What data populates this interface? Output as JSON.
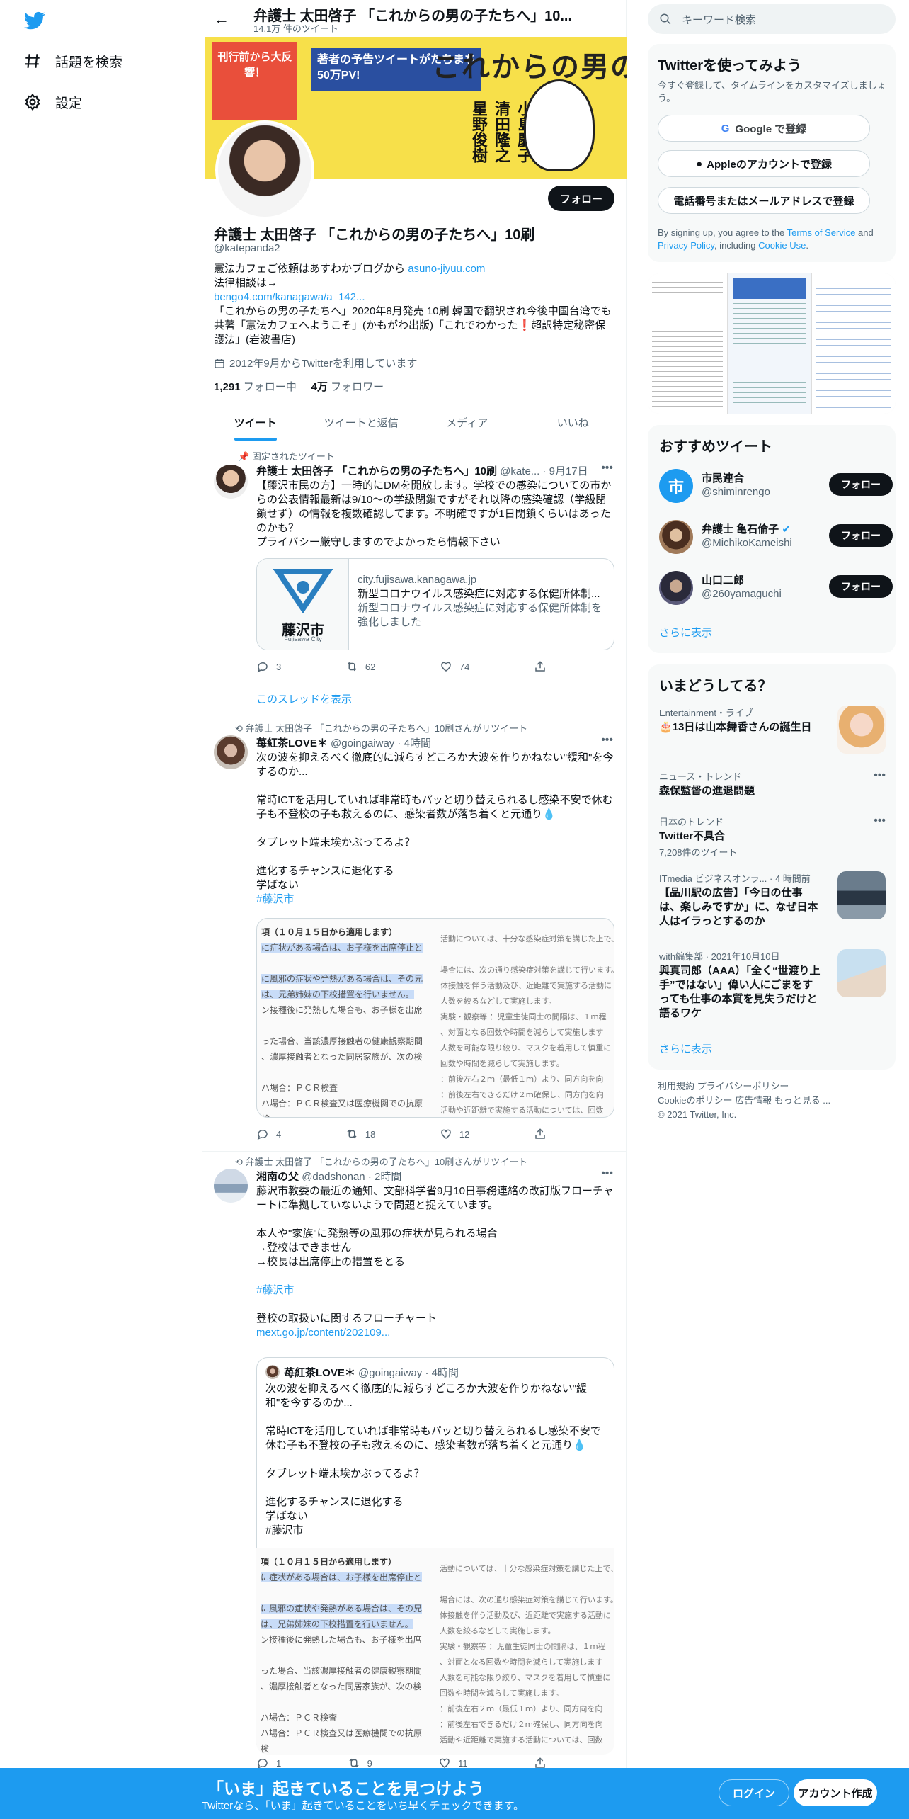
{
  "nav": {
    "explore_label": "話題を検索",
    "settings_label": "設定"
  },
  "header": {
    "title": "弁護士 太田啓子 「これからの男の子たちへ」10...",
    "tweet_count": "14.1万 件のツイート"
  },
  "banner": {
    "title": "これからの男の子たちへ",
    "badge": "刊行前から大反響！",
    "promo": "著者の予告ツイートがたちまち50万PV!",
    "names": "小島慶子 清田隆之 星野俊樹"
  },
  "profile": {
    "follow_label": "フォロー",
    "name": "弁護士 太田啓子 「これからの男の子たちへ」10刷",
    "handle": "@katepanda2",
    "bio_line1": "憲法カフェご依頼はあすわかブログから",
    "bio_link1": "asuno-jiyuu.com",
    "bio_line2": "法律相談は→",
    "bio_link2": "bengo4.com/kanagawa/a_142...",
    "bio_line3": "「これからの男の子たちへ」2020年8月発売 10刷 韓国で翻訳され今後中国台湾でも",
    "bio_line4": "共著「憲法カフェへようこそ」(かもがわ出版)「これでわかった❗超訳特定秘密保",
    "bio_line5": "護法」(岩波書店)",
    "joined": "2012年9月からTwitterを利用しています",
    "following_count": "1,291",
    "following_label": "フォロー中",
    "followers_count": "4万",
    "followers_label": "フォロワー"
  },
  "tabs": [
    "ツイート",
    "ツイートと返信",
    "メディア",
    "いいね"
  ],
  "tweet1": {
    "context": "固定されたツイート",
    "name": "弁護士 太田啓子 「これからの男の子たちへ」10刷",
    "meta": "@kate... · 9月17日",
    "lines": [
      "【藤沢市民の方】一時的にDMを開放します。学校での感染についての市か",
      "らの公表情報最新は9/10～の学級閉鎖ですがそれ以降の感染確認（学級閉",
      "鎖せず）の情報を複数確認してます。不明確ですが1日閉鎖くらいはあった",
      "のかも？",
      "プライバシー厳守しますのでよかったら情報下さい"
    ],
    "card_domain": "city.fujisawa.kanagawa.jp",
    "card_title": "新型コロナウイルス感染症に対応する保健所体制...",
    "card_desc1": "新型コロナウイルス感染症に対応する保健所体制を",
    "card_desc2": "強化しました",
    "card_logo_text": "藤沢市",
    "card_logo_sub": "Fujisawa City",
    "replies": "3",
    "retweets": "62",
    "likes": "74",
    "thread_link": "このスレッドを表示"
  },
  "tweet2": {
    "context": "弁護士 太田啓子 「これからの男の子たちへ」10刷さんがリツイート",
    "name": "苺紅茶LOVE＊",
    "meta": "@goingaiway · 4時間",
    "lines": [
      "次の波を抑えるべく徹底的に減らすどころか大波を作りかねない\"緩和\"を今",
      "するのか...",
      "",
      "常時ICTを活用していれば非常時もパッと切り替えられるし感染不安で休む",
      "子も不登校の子も救えるのに、感染者数が落ち着くと元通り💧",
      "",
      "タブレット端末埃かぶってるよ？",
      "",
      "進化するチャンスに退化する",
      "学ばない"
    ],
    "hashtag": "#藤沢市",
    "replies": "4",
    "retweets": "18",
    "likes": "12"
  },
  "doc": {
    "head": "項（１０月１５日から適用します）",
    "l1": "に症状がある場合は、お子様を出席停止と",
    "l2": "に風邪の症状や発熱がある場合は、その兄",
    "l3": "は、兄弟姉妹の下校措置を行いません。",
    "l4": "ン接種後に発熱した場合も、お子様を出席",
    "l5": "った場合、当該濃厚接触者の健康観察期間",
    "l6": "、濃厚接触者となった同居家族が、次の検",
    "l7": "ハ場合：ＰＣＲ検査",
    "l8": "ハ場合：ＰＣＲ検査又は医療機関での抗原検",
    "r1": "活動については、十分な感染症対策を講じた上で、",
    "r2": "場合には、次の通り感染症対策を講じて行います。",
    "r3": "体接触を伴う活動及び、近距離で実施する活動に",
    "r4": "人数を絞るなどして実施します。",
    "r5": "実験・観察等 ：児童生徒同士の間隔は、１ｍ程",
    "r6": "、対面となる回数や時間を減らして実施します",
    "r7": "人数を可能な限り絞り、マスクを着用して慎重に",
    "r8": "回数や時間を減らして実施します。",
    "r9": "：前後左右２ｍ（最低１ｍ）より、同方向を向",
    "r10": "：前後左右できるだけ２ｍ確保し、同方向を向",
    "r11": "活動や近距離で実施する活動については、回数"
  },
  "tweet3": {
    "context": "弁護士 太田啓子 「これからの男の子たちへ」10刷さんがリツイート",
    "name": "湘南の父",
    "meta": "@dadshonan · 2時間",
    "lines": [
      "藤沢市教委の最近の通知、文部科学省9月10日事務連絡の改訂版フローチャ",
      "ートに準拠していないようで問題と捉えています。",
      "",
      "本人や\"家族\"に発熱等の風邪の症状が見られる場合",
      "→登校はできません",
      "→校長は出席停止の措置をとる"
    ],
    "hashtag": "#藤沢市",
    "line_after": "登校の取扱いに関するフローチャート",
    "link": "mext.go.jp/content/202109...",
    "quote_name": "苺紅茶LOVE＊",
    "quote_meta": "@goingaiway · 4時間",
    "quote_lines": [
      "次の波を抑えるべく徹底的に減らすどころか大波を作りかねない\"緩",
      "和\"を今するのか...",
      "",
      "常時ICTを活用していれば非常時もパッと切り替えられるし感染不安で",
      "休む子も不登校の子も救えるのに、感染者数が落ち着くと元通り💧",
      "",
      "タブレット端末埃かぶってるよ？",
      "",
      "進化するチャンスに退化する",
      "学ばない",
      "#藤沢市"
    ],
    "replies": "1",
    "retweets": "9",
    "likes": "11"
  },
  "right": {
    "search_placeholder": "キーワード検索",
    "signup_title": "Twitterを使ってみよう",
    "signup_sub": "今すぐ登録して、タイムラインをカスタマイズしましょう。",
    "google_label": "Google で登録",
    "apple_label": "Appleのアカウントで登録",
    "phone_label": "電話番号またはメールアドレスで登録",
    "terms_pre": "By signing up, you agree to the ",
    "terms_link": "Terms of Service",
    "terms_mid": " and ",
    "privacy_link": "Privacy Policy",
    "terms_mid2": ", including ",
    "cookie_link": "Cookie Use",
    "terms_end": ".",
    "rec_title": "おすすめツイート",
    "recs": [
      {
        "name": "市民連合",
        "handle": "@shiminrengo",
        "follow": "フォロー"
      },
      {
        "name": "弁護士 亀石倫子",
        "handle": "@MichikoKameishi",
        "follow": "フォロー"
      },
      {
        "name": "山口二郎",
        "handle": "@260yamaguchi",
        "follow": "フォロー"
      }
    ],
    "show_more": "さらに表示",
    "trends_title": "いまどうしてる？",
    "trends": [
      {
        "meta": "Entertainment・ライブ",
        "title": "🎂13日は山本舞香さんの誕生日",
        "count": ""
      },
      {
        "meta": "ニュース・トレンド",
        "title": "森保監督の進退問題",
        "count": ""
      },
      {
        "meta": "日本のトレンド",
        "title": "Twitter不具合",
        "count": "7,208件のツイート"
      },
      {
        "meta": "ITmedia ビジネスオンラ... · 4 時間前",
        "title": "【品川駅の広告】「今日の仕事は、楽しみですか」に、なぜ日本人はイラっとするのか",
        "count": ""
      },
      {
        "meta": "with編集部 · 2021年10月10日",
        "title": "與真司郎（AAA）「全く“世渡り上手”ではない」偉い人にごまをすっても仕事の本質を見失うだけと語るワケ",
        "count": ""
      }
    ],
    "trends_more": "さらに表示",
    "footer1": "利用規約   プライバシーポリシー",
    "footer2": "Cookieのポリシー   広告情報   もっと見る ...",
    "footer3": "© 2021 Twitter, Inc."
  },
  "bottom": {
    "headline": "「いま」起きていることを見つけよう",
    "sub": "Twitterなら、「いま」起きていることをいち早くチェックできます。",
    "login": "ログイン",
    "signup": "アカウント作成"
  },
  "colors": {
    "accent": "#1d9bf0",
    "text": "#0f1419",
    "muted": "#536471"
  }
}
